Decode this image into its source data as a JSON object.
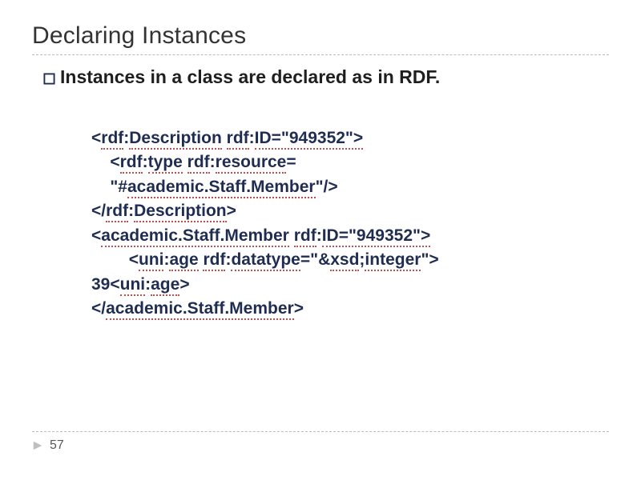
{
  "title": "Declaring Instances",
  "bullet": "Instances in a class are declared as in RDF.",
  "code": {
    "lines": [
      {
        "indent": 0,
        "runs": [
          {
            "t": "<",
            "d": false
          },
          {
            "t": "rdf",
            "d": true
          },
          {
            "t": ":",
            "d": false
          },
          {
            "t": "Description",
            "d": true
          },
          {
            "t": " ",
            "d": false
          },
          {
            "t": "rdf",
            "d": true
          },
          {
            "t": ":",
            "d": false
          },
          {
            "t": "ID=\"949352\">",
            "d": true
          }
        ]
      },
      {
        "indent": 1,
        "runs": [
          {
            "t": "<",
            "d": false
          },
          {
            "t": "rdf",
            "d": true
          },
          {
            "t": ":",
            "d": false
          },
          {
            "t": "type",
            "d": true
          },
          {
            "t": " ",
            "d": false
          },
          {
            "t": "rdf",
            "d": true
          },
          {
            "t": ":",
            "d": false
          },
          {
            "t": "resource",
            "d": true
          },
          {
            "t": "=",
            "d": false
          }
        ]
      },
      {
        "indent": 1,
        "runs": [
          {
            "t": "\"#",
            "d": false
          },
          {
            "t": "academic.Staff.Member",
            "d": true
          },
          {
            "t": "\"/>",
            "d": false
          }
        ]
      },
      {
        "indent": 0,
        "runs": [
          {
            "t": "</",
            "d": false
          },
          {
            "t": "rdf",
            "d": true
          },
          {
            "t": ":",
            "d": false
          },
          {
            "t": "Description",
            "d": true
          },
          {
            "t": ">",
            "d": false
          }
        ]
      },
      {
        "indent": 0,
        "runs": [
          {
            "t": "<",
            "d": false
          },
          {
            "t": "academic.Staff.Member",
            "d": true
          },
          {
            "t": " ",
            "d": false
          },
          {
            "t": "rdf",
            "d": true
          },
          {
            "t": ":",
            "d": false
          },
          {
            "t": "ID=\"949352\">",
            "d": true
          }
        ]
      },
      {
        "indent": 2,
        "runs": [
          {
            "t": "<",
            "d": false
          },
          {
            "t": "uni",
            "d": true
          },
          {
            "t": ":",
            "d": false
          },
          {
            "t": "age",
            "d": true
          },
          {
            "t": " ",
            "d": false
          },
          {
            "t": "rdf",
            "d": true
          },
          {
            "t": ":",
            "d": false
          },
          {
            "t": "datatype",
            "d": true
          },
          {
            "t": "=\"&",
            "d": false
          },
          {
            "t": "xsd",
            "d": true
          },
          {
            "t": ";",
            "d": false
          },
          {
            "t": "integer",
            "d": true
          },
          {
            "t": "\">",
            "d": false
          }
        ]
      },
      {
        "indent": 0,
        "runs": [
          {
            "t": "39<",
            "d": false
          },
          {
            "t": "uni",
            "d": true
          },
          {
            "t": ":",
            "d": false
          },
          {
            "t": "age",
            "d": true
          },
          {
            "t": ">",
            "d": false
          }
        ]
      },
      {
        "indent": 0,
        "runs": [
          {
            "t": "</",
            "d": false
          },
          {
            "t": "academic.Staff.Member",
            "d": true
          },
          {
            "t": ">",
            "d": false
          }
        ]
      }
    ]
  },
  "page_number": "57",
  "colors": {
    "text_dark": "#1f2d52",
    "underline": "#c0504d",
    "rule": "#bbbbbb"
  }
}
